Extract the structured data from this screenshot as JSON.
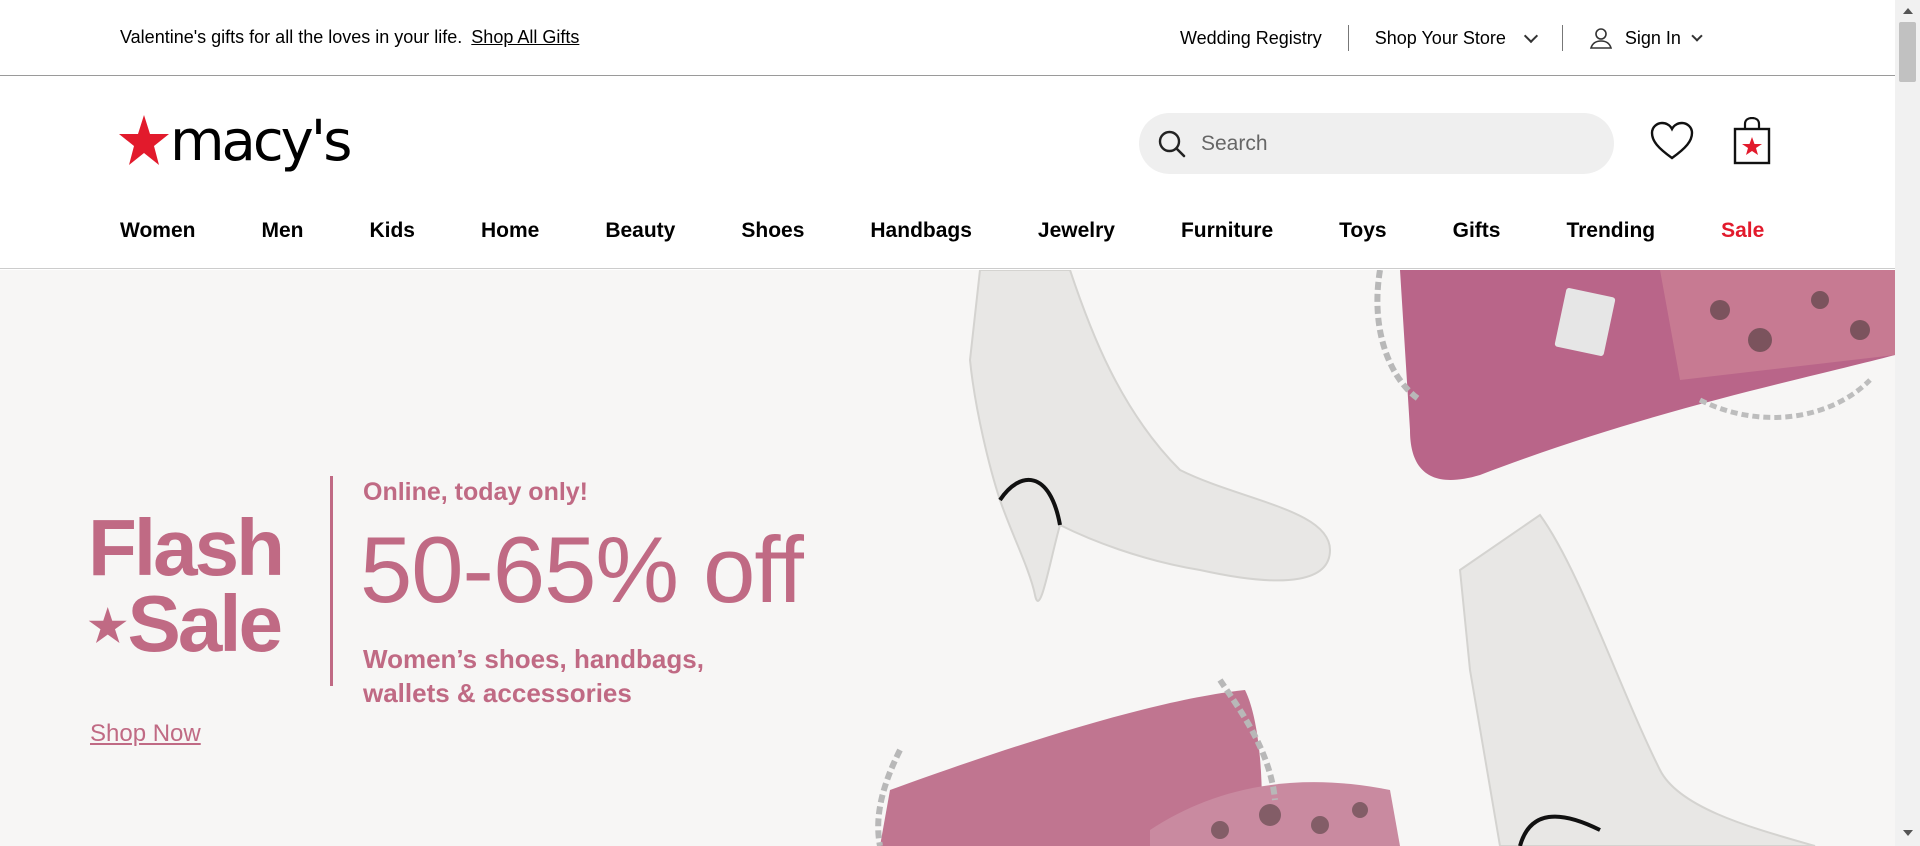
{
  "utility_bar": {
    "promo_text": "Valentine's gifts for all the loves in your life.",
    "promo_link": "Shop All Gifts",
    "wedding_registry": "Wedding Registry",
    "shop_your_store": "Shop Your Store",
    "sign_in": "Sign In"
  },
  "header": {
    "logo_text": "macy's",
    "search_placeholder": "Search",
    "icons": [
      "search-icon",
      "heart-icon",
      "shopping-bag-icon",
      "user-icon"
    ]
  },
  "nav": {
    "items": [
      "Women",
      "Men",
      "Kids",
      "Home",
      "Beauty",
      "Shoes",
      "Handbags",
      "Jewelry",
      "Furniture",
      "Toys",
      "Gifts",
      "Trending",
      "Sale"
    ]
  },
  "hero": {
    "flash_line1": "Flash",
    "flash_line2": "Sale",
    "online": "Online, today only!",
    "discount": "50-65% off",
    "description": "Women’s shoes, handbags, wallets & accessories",
    "cta": "Shop Now"
  },
  "colors": {
    "brand_red": "#e21a2c",
    "hero_pink": "#c06a84",
    "hero_bg": "#f7f6f5"
  }
}
